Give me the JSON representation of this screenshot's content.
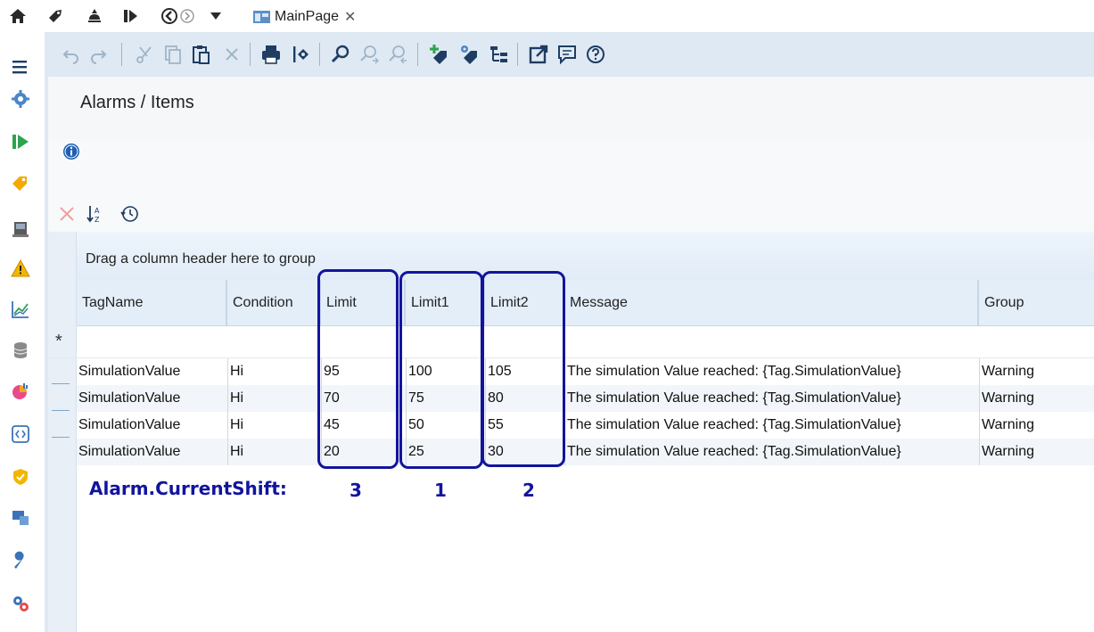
{
  "window": {
    "tab_label": "MainPage",
    "tab_close": "✕"
  },
  "toolbar": {
    "tools": [
      "undo-icon",
      "redo-icon",
      "cut-icon",
      "copy-icon",
      "paste-icon",
      "delete-icon",
      "print-icon",
      "import-export-icon",
      "find-icon",
      "find-next-icon",
      "find-previous-icon",
      "add-tag-icon",
      "tag-settings-icon",
      "tree-icon",
      "open-external-icon",
      "comment-icon",
      "help-icon"
    ]
  },
  "sidebar": {
    "items": [
      "menu-icon",
      "settings-icon",
      "runtime-icon",
      "tags-icon",
      "devices-icon",
      "alarms-icon",
      "historian-icon",
      "datasets-icon",
      "reports-icon",
      "scripts-icon",
      "security-icon",
      "displays-icon",
      "tools-icon",
      "solution-icon"
    ]
  },
  "page": {
    "breadcrumb": "Alarms / Items"
  },
  "grid": {
    "group_hint": "Drag a column header here to group",
    "new_row_marker": "*",
    "columns": [
      "TagName",
      "Condition",
      "Limit",
      "Limit1",
      "Limit2",
      "Message",
      "Group"
    ],
    "rows": [
      {
        "tagname": "SimulationValue",
        "condition": "Hi",
        "limit": "95",
        "limit1": "100",
        "limit2": "105",
        "message": "The simulation Value reached: {Tag.SimulationValue}",
        "group": "Warning"
      },
      {
        "tagname": "SimulationValue",
        "condition": "Hi",
        "limit": "70",
        "limit1": "75",
        "limit2": "80",
        "message": "The simulation Value reached: {Tag.SimulationValue}",
        "group": "Warning"
      },
      {
        "tagname": "SimulationValue",
        "condition": "Hi",
        "limit": "45",
        "limit1": "50",
        "limit2": "55",
        "message": "The simulation Value reached: {Tag.SimulationValue}",
        "group": "Warning"
      },
      {
        "tagname": "SimulationValue",
        "condition": "Hi",
        "limit": "20",
        "limit1": "25",
        "limit2": "30",
        "message": "The simulation Value reached: {Tag.SimulationValue}",
        "group": "Warning"
      }
    ]
  },
  "annotation": {
    "label": "Alarm.CurrentShift:",
    "limit_shift": "3",
    "limit1_shift": "1",
    "limit2_shift": "2",
    "color": "#12149e"
  }
}
